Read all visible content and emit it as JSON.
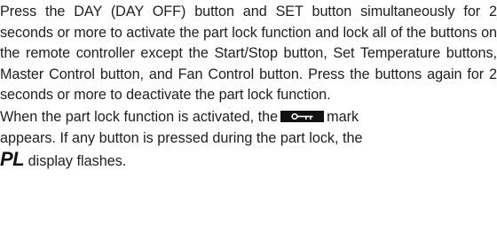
{
  "paragraph1": "Press the DAY (DAY OFF) button and SET button simultaneously for 2 seconds or more to activate the part lock function and lock all of the buttons on the remote controller except the Start/Stop button, Set Temperature buttons, Master Control button, and Fan Control button. Press the buttons again for 2 seconds or more to deactivate the part lock function.",
  "paragraph2": {
    "before_mark": "When the part lock function is activated, the",
    "mark_icon": "key-lock-icon",
    "after_mark": "mark",
    "line2": "appears. If any button is pressed during the part lock, the",
    "pl_label": "PL",
    "after_pl": "display flashes."
  }
}
